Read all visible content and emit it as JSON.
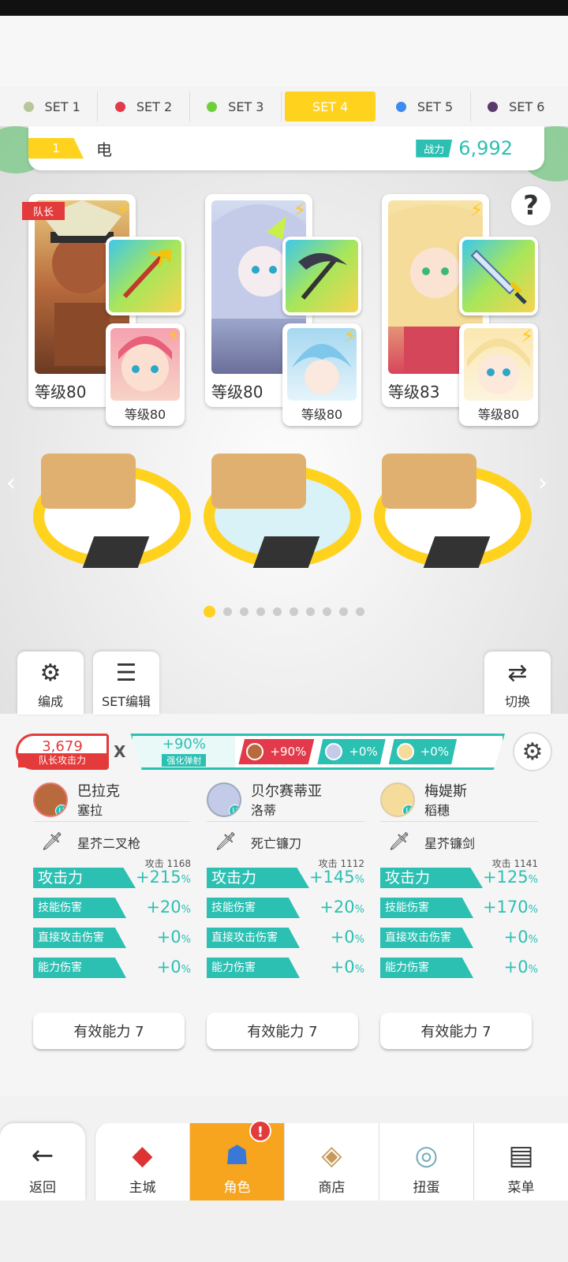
{
  "set_tabs": [
    {
      "label": "SET 1",
      "color": "#b7c79b"
    },
    {
      "label": "SET 2",
      "color": "#e23a4a"
    },
    {
      "label": "SET 3",
      "color": "#6fcf3a"
    },
    {
      "label": "SET 4",
      "color": "#ffd21e"
    },
    {
      "label": "SET 5",
      "color": "#3d8af0"
    },
    {
      "label": "SET 6",
      "color": "#5a3a6a"
    }
  ],
  "active_set": 4,
  "team": {
    "number": "1",
    "name": "电",
    "power_label": "战力",
    "power_value": "6,992"
  },
  "leader_tag": "队长",
  "cards": [
    {
      "level": "等级80",
      "sub_level": "等级80",
      "weapon_icon": "trident-icon"
    },
    {
      "level": "等级80",
      "sub_level": "等级80",
      "weapon_icon": "scythe-icon"
    },
    {
      "level": "等级83",
      "sub_level": "等级80",
      "weapon_icon": "sword-icon"
    }
  ],
  "side_buttons": {
    "formation": "编成",
    "set_edit": "SET编辑",
    "switch": "切换"
  },
  "page_dots": 10,
  "leader_attack": {
    "value": "3,679",
    "label": "队长攻击力"
  },
  "times_symbol": "X",
  "boost": {
    "value": "+90%",
    "label": "强化弹射"
  },
  "chips": [
    {
      "value": "+90%",
      "color": "#e23a4a"
    },
    {
      "value": "+0%",
      "color": "#2cc0b3"
    },
    {
      "value": "+0%",
      "color": "#2cc0b3"
    }
  ],
  "columns": [
    {
      "name": "巴拉克",
      "sub": "塞拉",
      "weapon": "星芥二叉枪",
      "atk_mini": "攻击 1168",
      "stats": [
        {
          "label": "攻击力",
          "value": "+215",
          "unit": "%"
        },
        {
          "label": "技能伤害",
          "value": "+20",
          "unit": "%"
        },
        {
          "label": "直接攻击伤害",
          "value": "+0",
          "unit": "%"
        },
        {
          "label": "能力伤害",
          "value": "+0",
          "unit": "%"
        }
      ],
      "effective": "有效能力 7"
    },
    {
      "name": "贝尔赛蒂亚",
      "sub": "洛蒂",
      "weapon": "死亡镰刀",
      "atk_mini": "攻击 1112",
      "stats": [
        {
          "label": "攻击力",
          "value": "+145",
          "unit": "%"
        },
        {
          "label": "技能伤害",
          "value": "+20",
          "unit": "%"
        },
        {
          "label": "直接攻击伤害",
          "value": "+0",
          "unit": "%"
        },
        {
          "label": "能力伤害",
          "value": "+0",
          "unit": "%"
        }
      ],
      "effective": "有效能力 7"
    },
    {
      "name": "梅媞斯",
      "sub": "稻穗",
      "weapon": "星芥镰剑",
      "atk_mini": "攻击 1141",
      "stats": [
        {
          "label": "攻击力",
          "value": "+125",
          "unit": "%"
        },
        {
          "label": "技能伤害",
          "value": "+170",
          "unit": "%"
        },
        {
          "label": "直接攻击伤害",
          "value": "+0",
          "unit": "%"
        },
        {
          "label": "能力伤害",
          "value": "+0",
          "unit": "%"
        }
      ],
      "effective": "有效能力 7"
    }
  ],
  "nav": {
    "back": "返回",
    "city": "主城",
    "character": "角色",
    "shop": "商店",
    "gacha": "扭蛋",
    "menu": "菜单",
    "badge": "!"
  }
}
